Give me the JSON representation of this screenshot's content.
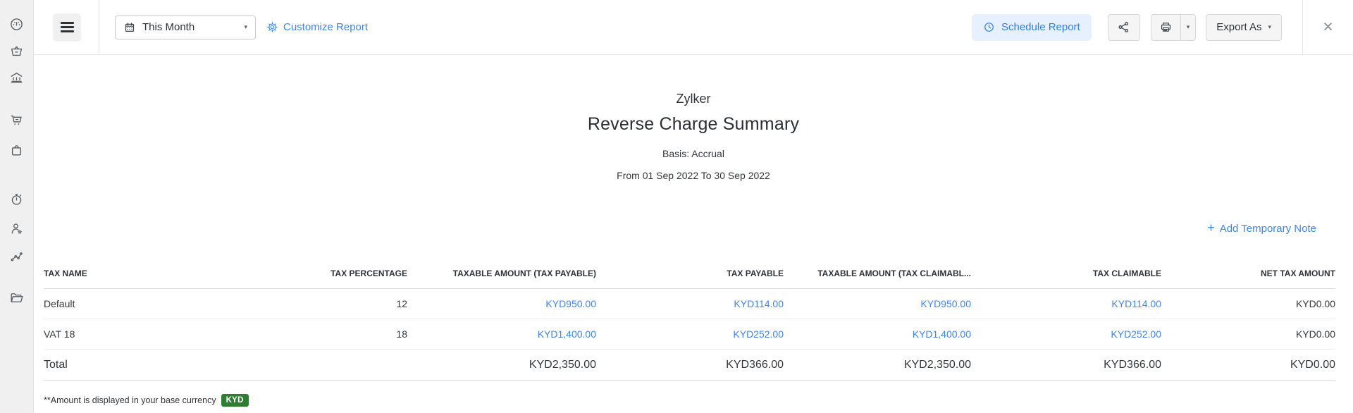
{
  "sidebar": {
    "icons": [
      "dashboard-gauge",
      "items-basket",
      "banking-bank",
      "sales-cart",
      "purchases-bag",
      "time-tracking-timer",
      "accountant-person-star",
      "reports-chart",
      "documents-folder"
    ]
  },
  "toolbar": {
    "date_range_label": "This Month",
    "customize_label": "Customize Report",
    "schedule_label": "Schedule Report",
    "export_label": "Export As",
    "close_label": "×"
  },
  "report": {
    "org_name": "Zylker",
    "title": "Reverse Charge Summary",
    "basis": "Basis: Accrual",
    "date_range": "From 01 Sep 2022 To 30 Sep 2022",
    "add_note_label": "Add Temporary Note"
  },
  "table": {
    "columns": [
      "TAX NAME",
      "TAX PERCENTAGE",
      "TAXABLE AMOUNT (TAX PAYABLE)",
      "TAX PAYABLE",
      "TAXABLE AMOUNT (TAX CLAIMABL...",
      "TAX CLAIMABLE",
      "NET TAX AMOUNT"
    ],
    "link_columns": [
      2,
      3,
      4,
      5
    ],
    "rows": [
      [
        "Default",
        "12",
        "KYD950.00",
        "KYD114.00",
        "KYD950.00",
        "KYD114.00",
        "KYD0.00"
      ],
      [
        "VAT 18",
        "18",
        "KYD1,400.00",
        "KYD252.00",
        "KYD1,400.00",
        "KYD252.00",
        "KYD0.00"
      ]
    ],
    "total": [
      "Total",
      "",
      "KYD2,350.00",
      "KYD366.00",
      "KYD2,350.00",
      "KYD366.00",
      "KYD0.00"
    ]
  },
  "footer": {
    "note": "**Amount is displayed in your base currency",
    "currency_badge": "KYD"
  },
  "colors": {
    "link-blue": "#3c85f6",
    "schedule-bg": "#e7f0fe",
    "schedule-blue": "#2d7ff0",
    "badge-green": "#2e7d32"
  }
}
